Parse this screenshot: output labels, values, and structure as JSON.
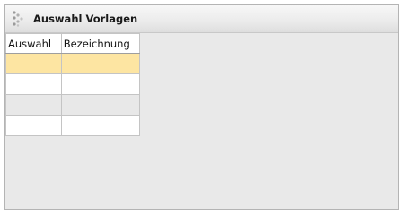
{
  "panel": {
    "title": "Auswahl Vorlagen",
    "icon": "grip-icon"
  },
  "table": {
    "columns": [
      "Auswahl",
      "Bezeichnung"
    ],
    "rows": [
      {
        "auswahl": "",
        "bezeichnung": "",
        "selected": true
      },
      {
        "auswahl": "",
        "bezeichnung": "",
        "selected": false
      },
      {
        "auswahl": "",
        "bezeichnung": "",
        "selected": false
      },
      {
        "auswahl": "",
        "bezeichnung": "",
        "selected": false
      }
    ]
  },
  "colors": {
    "selected_row": "#fde5a2",
    "alt_row": "#e8e8e8",
    "panel_bg": "#e9e9e9"
  }
}
